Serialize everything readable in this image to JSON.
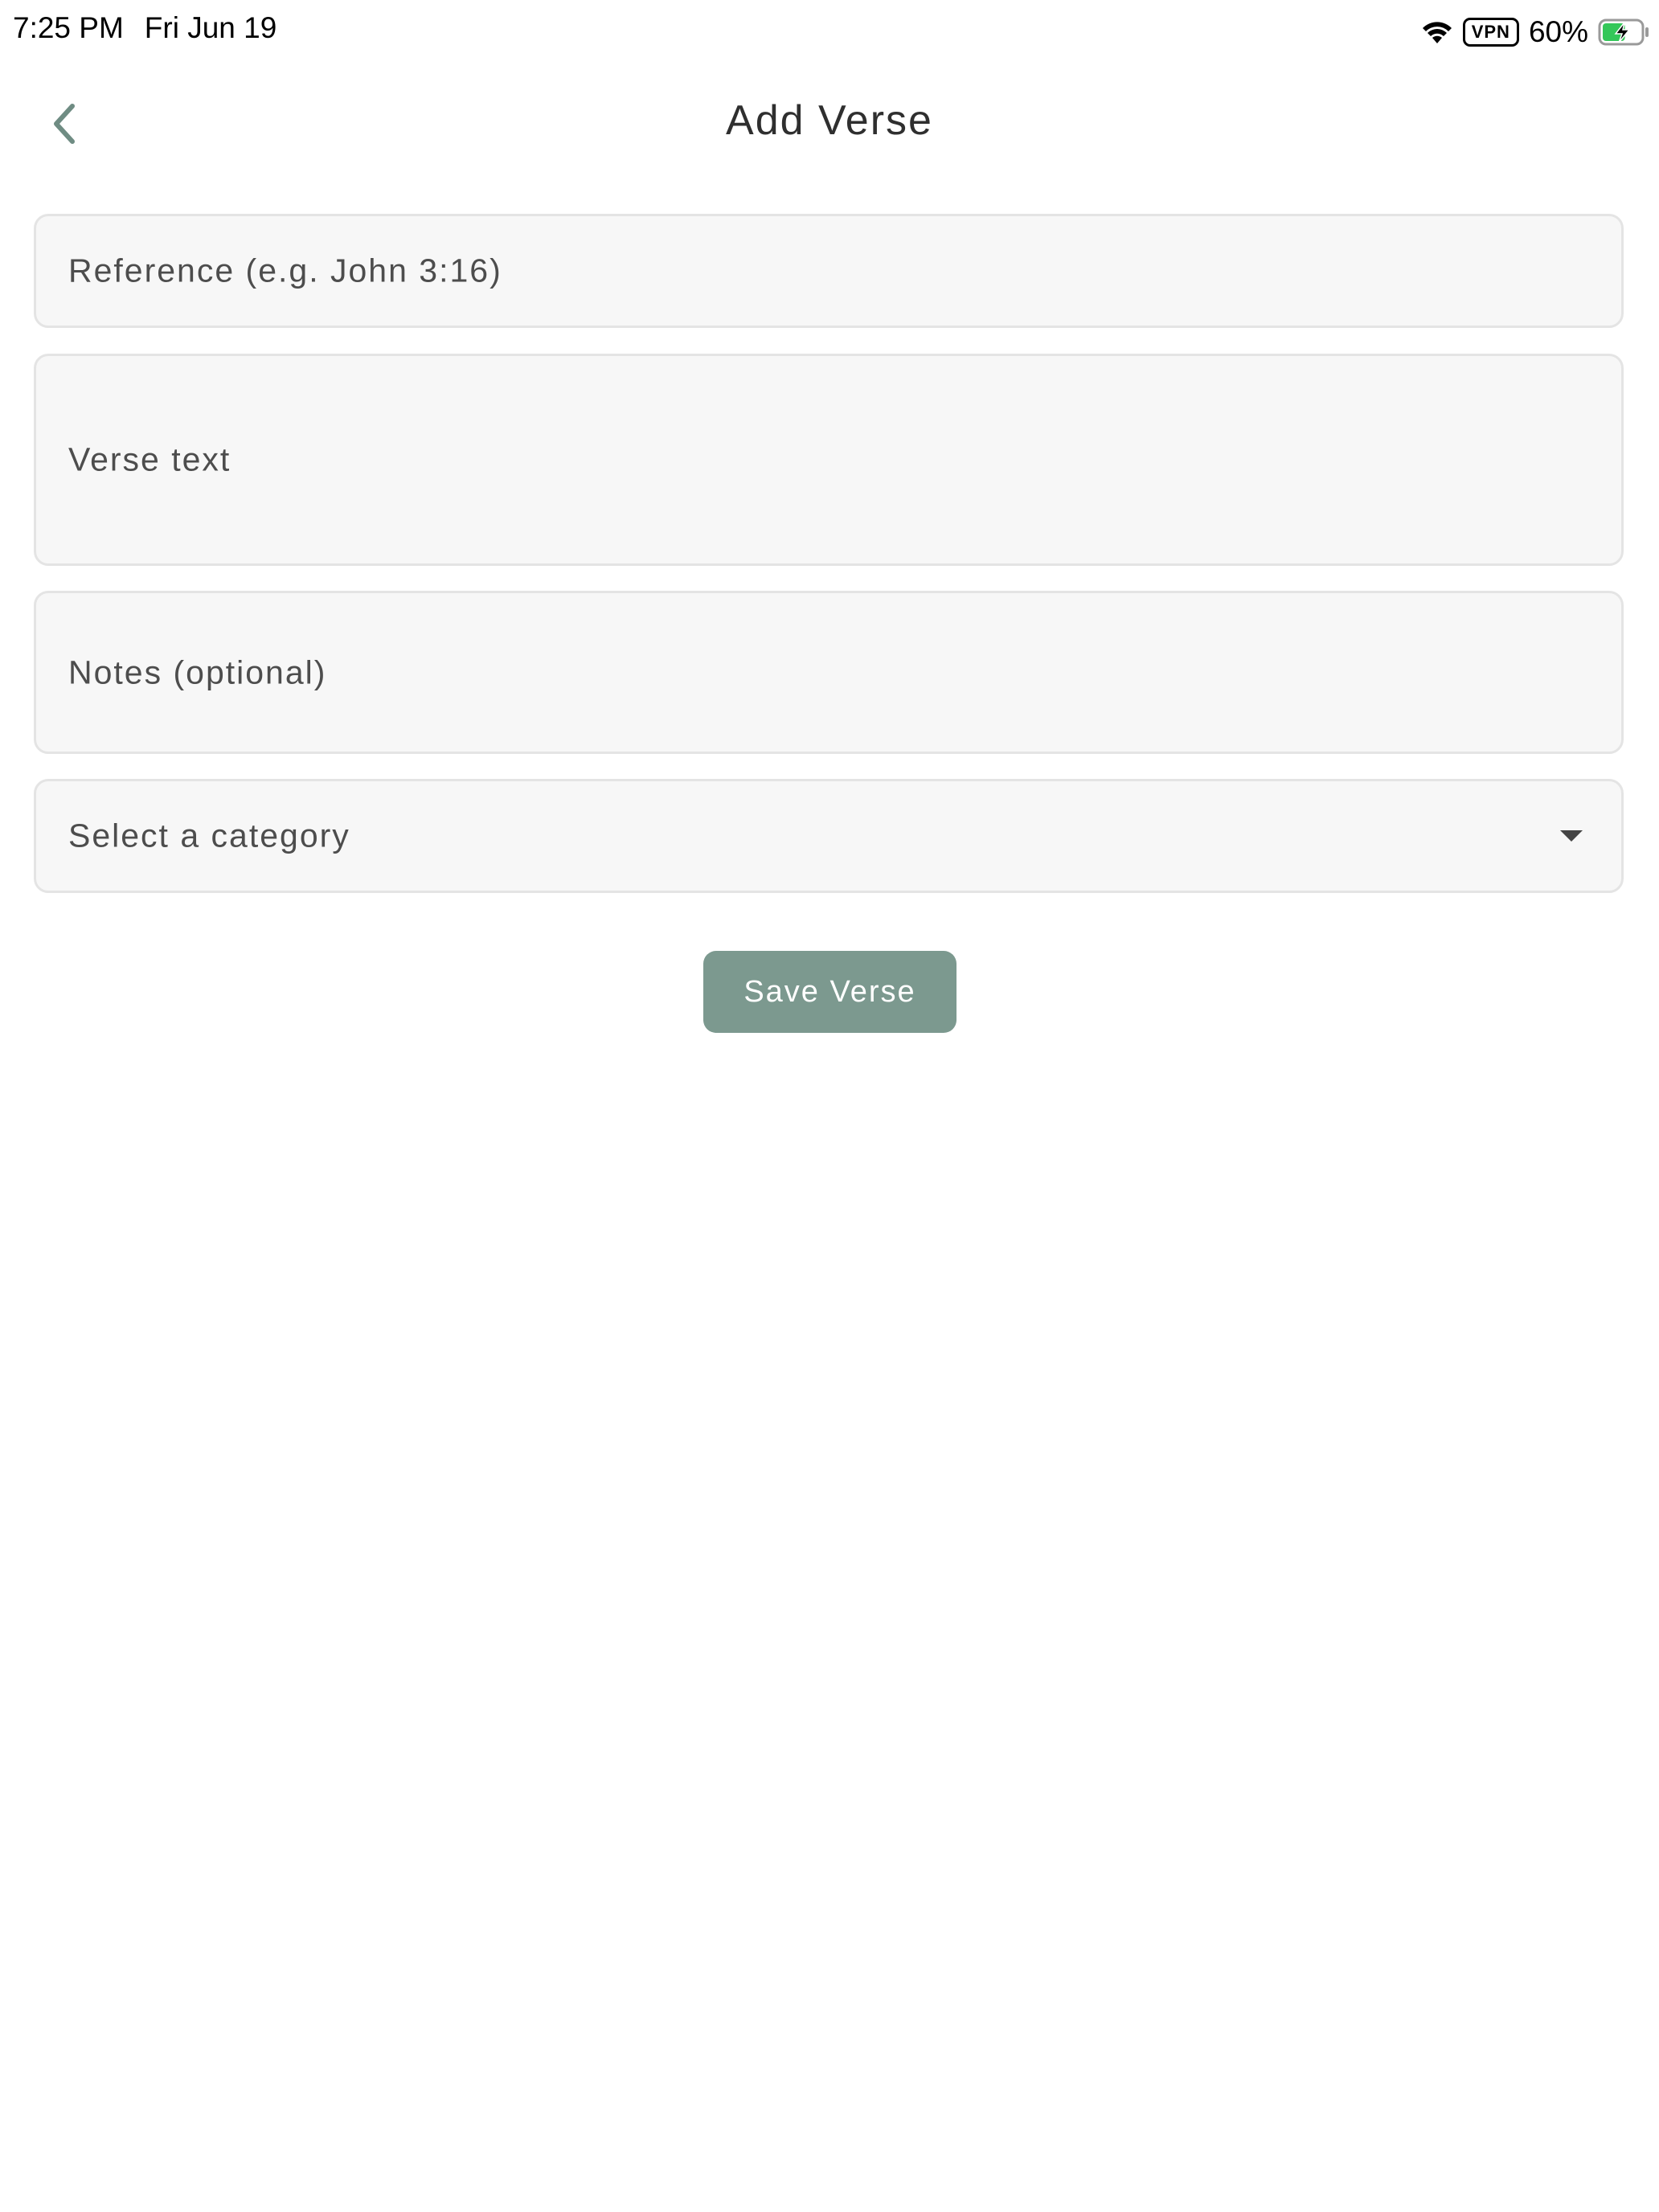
{
  "status_bar": {
    "time": "7:25 PM",
    "date": "Fri Jun 19",
    "vpn_label": "VPN",
    "battery": "60%",
    "battery_level": 0.6,
    "icons": [
      "wifi-icon",
      "battery-charging-icon"
    ]
  },
  "header": {
    "title": "Add Verse",
    "back_icon": "chevron-left-icon"
  },
  "form": {
    "reference": {
      "placeholder": "Reference (e.g. John 3:16)",
      "value": ""
    },
    "verse_text": {
      "placeholder": "Verse text",
      "value": ""
    },
    "notes": {
      "placeholder": "Notes (optional)",
      "value": ""
    },
    "category": {
      "placeholder": "Select a category",
      "selected": "",
      "icon": "dropdown-arrow-icon"
    }
  },
  "actions": {
    "save_label": "Save Verse"
  },
  "colors": {
    "accent": "#7c998f",
    "field_bg": "#f7f7f7",
    "field_border": "#e4e4e4",
    "battery_fill": "#34c759"
  }
}
